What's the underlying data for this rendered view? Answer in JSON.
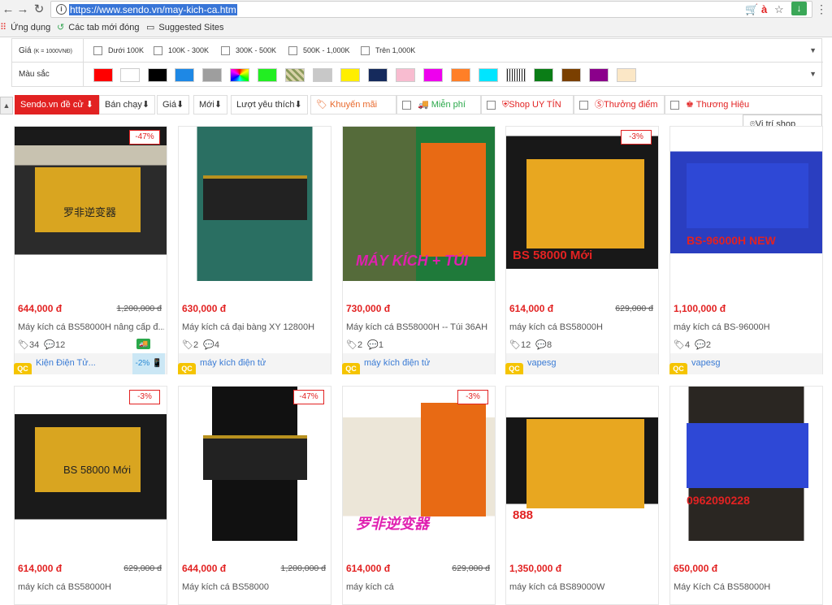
{
  "browser": {
    "url": "https://www.sendo.vn/may-kich-ca.htm",
    "bookmarks": [
      "Ứng dụng",
      "Các tab mới đóng",
      "Suggested Sites"
    ]
  },
  "filters": {
    "price_label": "Giá",
    "price_unit": "(K = 1000VNĐ)",
    "price_options": [
      "Dưới 100K",
      "100K - 300K",
      "300K - 500K",
      "500K - 1,000K",
      "Trên 1,000K"
    ],
    "color_label": "Màu sắc",
    "colors": [
      "#ff0000",
      "#ffffff",
      "#000000",
      "#1e88e5",
      "#9e9e9e",
      "multicolor",
      "#22ee22",
      "pattern",
      "#c8c8c8",
      "#ffee00",
      "#152a5c",
      "#f8bcd0",
      "#ee00ee",
      "#ff7f27",
      "#00e5ff",
      "stripes",
      "#0a7d16",
      "#7a3f00",
      "#8b008b",
      "#fbe7c6"
    ]
  },
  "sort": {
    "items": [
      "Sendo.vn đề cử",
      "Bán chạy",
      "Giá",
      "Mới",
      "Lượt yêu thích"
    ],
    "promo": "Khuyến mãi",
    "free_ship": "Miễn phí",
    "uy_tin": "Shop UY TÍN",
    "points": "Thưởng điểm",
    "brand": "Thương Hiệu",
    "location": "Vị trí shop"
  },
  "products": [
    {
      "price": "644,000 đ",
      "old": "1,200,000 đ",
      "disc": "-47%",
      "name": "Máy kích cá BS58000H nâng cấp đ...",
      "likes": "34",
      "comments": "12",
      "shop": "Kiện Điện Tử...",
      "badge": "-2%",
      "img_text": "罗非逆变器"
    },
    {
      "price": "630,000 đ",
      "old": "",
      "disc": "",
      "name": "Máy kích cá đại bàng XY 12800H",
      "likes": "2",
      "comments": "4",
      "shop": "máy kích điện tử",
      "badge": "",
      "img_text": ""
    },
    {
      "price": "730,000 đ",
      "old": "",
      "disc": "",
      "name": "Máy kích cá BS58000H -- Túi 36AH",
      "likes": "2",
      "comments": "1",
      "shop": "máy kích điện tử",
      "badge": "",
      "img_text": "MÁY KÍCH + TÚI"
    },
    {
      "price": "614,000 đ",
      "old": "629,000 đ",
      "disc": "-3%",
      "name": "máy kích cá BS58000H",
      "likes": "12",
      "comments": "8",
      "shop": "vapesg",
      "badge": "",
      "img_text": "BS 58000   Mới"
    },
    {
      "price": "1,100,000 đ",
      "old": "",
      "disc": "",
      "name": "máy kích cá BS-96000H",
      "likes": "4",
      "comments": "2",
      "shop": "vapesg",
      "badge": "",
      "img_text": "BS-96000H    NEW"
    },
    {
      "price": "614,000 đ",
      "old": "629,000 đ",
      "disc": "-3%",
      "name": "máy kích cá BS58000H",
      "likes": "",
      "comments": "",
      "shop": "",
      "badge": "",
      "img_text": "BS 58000   Mới"
    },
    {
      "price": "644,000 đ",
      "old": "1,200,000 đ",
      "disc": "-47%",
      "name": "Máy kích cá BS58000",
      "likes": "",
      "comments": "",
      "shop": "",
      "badge": "",
      "img_text": ""
    },
    {
      "price": "614,000 đ",
      "old": "629,000 đ",
      "disc": "-3%",
      "name": "máy kích cá",
      "likes": "",
      "comments": "",
      "shop": "",
      "badge": "",
      "img_text": "罗非逆变器"
    },
    {
      "price": "1,350,000 đ",
      "old": "",
      "disc": "",
      "name": "máy kích cá BS89000W",
      "likes": "",
      "comments": "",
      "shop": "",
      "badge": "",
      "img_text": "888"
    },
    {
      "price": "650,000 đ",
      "old": "",
      "disc": "",
      "name": "Máy Kích Cá BS58000H",
      "likes": "",
      "comments": "",
      "shop": "",
      "badge": "",
      "img_text": "0962090228"
    }
  ],
  "qc": "QC"
}
